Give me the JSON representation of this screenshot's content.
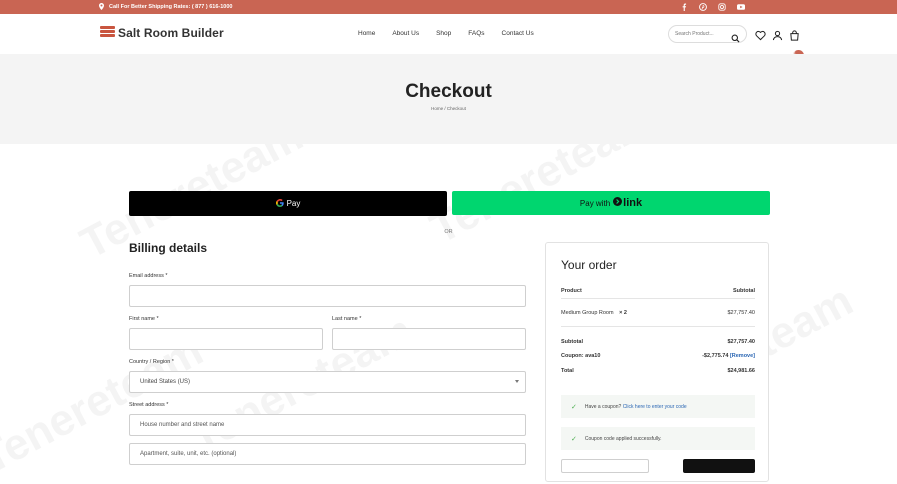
{
  "topbar": {
    "call_text": "Call For Better Shipping Rates: ( 877 ) 616-1000"
  },
  "brand": {
    "name": "Salt Room Builder",
    "accent": "#c96553"
  },
  "nav": {
    "items": [
      "Home",
      "About Us",
      "Shop",
      "FAQs",
      "Contact Us"
    ]
  },
  "search": {
    "placeholder": "Search Product..."
  },
  "cart": {
    "count": "2"
  },
  "hero": {
    "title": "Checkout",
    "crumb_home": "Home",
    "crumb_sep": "/",
    "crumb_current": "Checkout"
  },
  "payments": {
    "gpay_label": "Pay",
    "link_prefix": "Pay with",
    "link_brand": "link",
    "or_text": "OR"
  },
  "billing": {
    "title": "Billing details",
    "email_label": "Email address *",
    "first_name_label": "First name *",
    "last_name_label": "Last name *",
    "country_label": "Country / Region *",
    "country_value": "United States (US)",
    "street_label": "Street address *",
    "street_placeholder": "House number and street name",
    "apt_placeholder": "Apartment, suite, unit, etc. (optional)"
  },
  "order": {
    "title": "Your order",
    "col_product": "Product",
    "col_subtotal": "Subtotal",
    "item_name": "Medium Group Room",
    "item_qty": "× 2",
    "item_price": "$27,757.40",
    "subtotal_label": "Subtotal",
    "subtotal_value": "$27,757.40",
    "coupon_label": "Coupon: ava10",
    "coupon_value": "-$2,775.74",
    "coupon_remove": "[Remove]",
    "total_label": "Total",
    "total_value": "$24,981.66",
    "have_coupon_text": "Have a coupon?",
    "have_coupon_link": "Click here to enter your code",
    "coupon_success": "Coupon code applied successfully."
  },
  "watermark": {
    "text": "Tenereteam"
  }
}
